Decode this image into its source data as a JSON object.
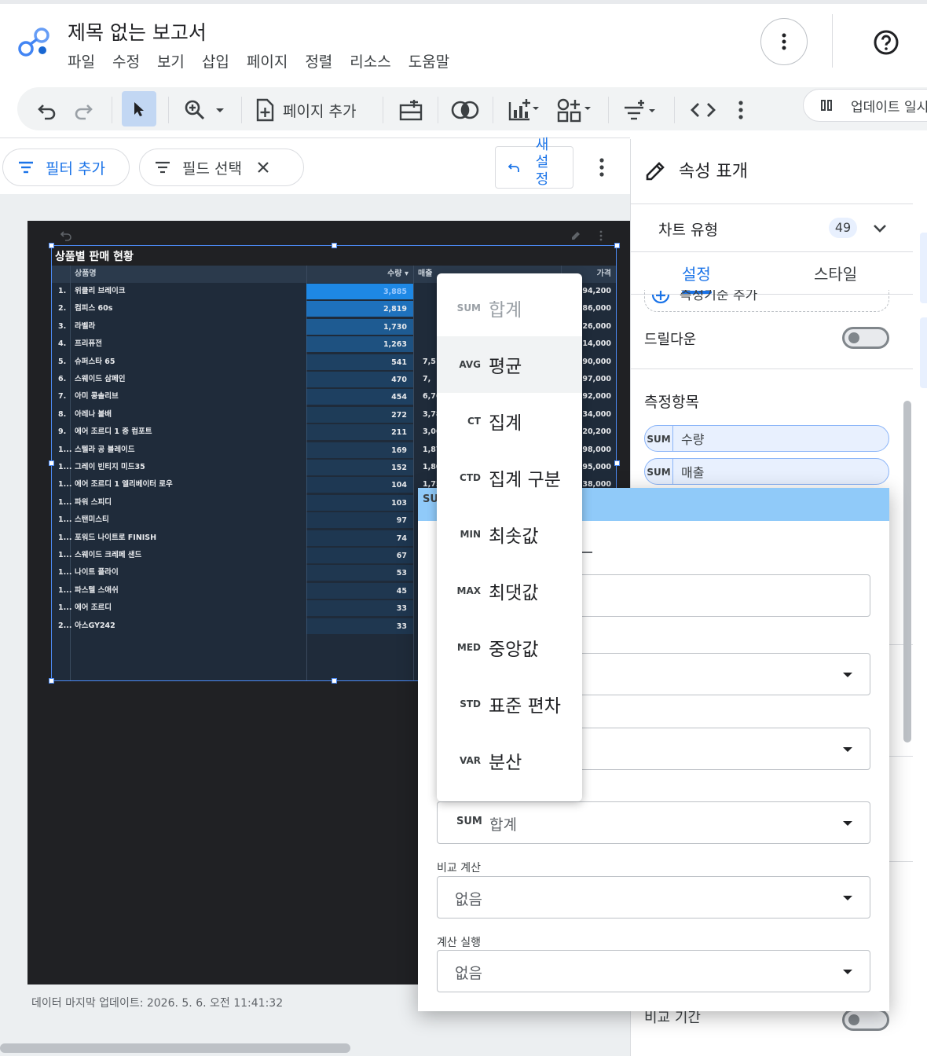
{
  "app": {
    "title": "제목 없는 보고서",
    "menu": [
      "파일",
      "수정",
      "보기",
      "삽입",
      "페이지",
      "정렬",
      "리소스",
      "도움말"
    ]
  },
  "toolbar": {
    "add_page_label": "페이지 추가",
    "update_label": "업데이트 일시"
  },
  "filterbar": {
    "add_filter_label": "필터 추가",
    "field_select_label": "필드 선택",
    "reset_label_lines": [
      "새",
      "설",
      "정"
    ]
  },
  "report": {
    "table_title": "상품별 판매 현황",
    "columns": {
      "name": "상품명",
      "qty": "수량 ▾",
      "revenue": "매출",
      "price": "가격"
    },
    "rows": [
      {
        "rank": "1.",
        "name": "위클리 브레이크",
        "qty": "3,885",
        "revenue": "",
        "price": ",794,200",
        "shade": 1.0
      },
      {
        "rank": "2.",
        "name": "컴피스 60s",
        "qty": "2,819",
        "revenue": "",
        "price": ",886,000",
        "shade": 0.73
      },
      {
        "rank": "3.",
        "name": "라벨라",
        "qty": "1,730",
        "revenue": "",
        "price": ",126,000",
        "shade": 0.45
      },
      {
        "rank": "4.",
        "name": "프리퓨전",
        "qty": "1,263",
        "revenue": "",
        "price": ",314,000",
        "shade": 0.33
      },
      {
        "rank": "5.",
        "name": "슈퍼스타 65",
        "qty": "541",
        "revenue": "7,51",
        "price": ",390,000",
        "shade": 0.14
      },
      {
        "rank": "6.",
        "name": "스웨이드 삼페인",
        "qty": "470",
        "revenue": "7,",
        "price": ",197,000",
        "shade": 0.12
      },
      {
        "rank": "7.",
        "name": "아미 콩솔리브",
        "qty": "454",
        "revenue": "6,76",
        "price": ",192,000",
        "shade": 0.12
      },
      {
        "rank": "8.",
        "name": "아레나 볼배",
        "qty": "272",
        "revenue": "3,78",
        "price": "834,000",
        "shade": 0.07
      },
      {
        "rank": "9.",
        "name": "에어 조르디 1 중 컴포트",
        "qty": "211",
        "revenue": "3,06",
        "price": "820,200",
        "shade": 0.05
      },
      {
        "rank": "1...",
        "name": "스텔라 공 블레이드",
        "qty": "169",
        "revenue": "1,87",
        "price": "198,000",
        "shade": 0.04
      },
      {
        "rank": "1...",
        "name": "그레이 빈티지 미드35",
        "qty": "152",
        "revenue": "1,80",
        "price": "595,000",
        "shade": 0.04
      },
      {
        "rank": "1...",
        "name": "에어 조르디 1 엘리베이터 로우",
        "qty": "104",
        "revenue": "1,75",
        "price": "338,000",
        "shade": 0.03
      },
      {
        "rank": "1...",
        "name": "파워 스피디",
        "qty": "103",
        "revenue": "",
        "price": "",
        "shade": 0.03
      },
      {
        "rank": "1...",
        "name": "스탠미스티",
        "qty": "97",
        "revenue": "",
        "price": "",
        "shade": 0.02
      },
      {
        "rank": "1...",
        "name": "포워드 나이트로 FINISH",
        "qty": "74",
        "revenue": "",
        "price": "",
        "shade": 0.02
      },
      {
        "rank": "1...",
        "name": "스웨이드 크레페 샌드",
        "qty": "67",
        "revenue": "",
        "price": "",
        "shade": 0.02
      },
      {
        "rank": "1...",
        "name": "나이트 플라이",
        "qty": "53",
        "revenue": "",
        "price": "",
        "shade": 0.01
      },
      {
        "rank": "1...",
        "name": "파스텔 스애쉬",
        "qty": "45",
        "revenue": "",
        "price": "",
        "shade": 0.01
      },
      {
        "rank": "1...",
        "name": "에어 조르디",
        "qty": "33",
        "revenue": "",
        "price": "",
        "shade": 0.01
      },
      {
        "rank": "2...",
        "name": "아스GY242",
        "qty": "33",
        "revenue": "",
        "price": "",
        "shade": 0.01
      }
    ],
    "footnote": "데이터 마지막 업데이트: 2026. 5. 6. 오전 11:41:32"
  },
  "panel": {
    "title": "속성 표개",
    "chart_type_label": "차트 유형",
    "chart_type_count": "49",
    "tabs": [
      "설정",
      "스타일"
    ],
    "add_metric_label": "측정기준 추가",
    "drilldown_label": "드릴다운",
    "metrics_label": "측정항목",
    "metrics": [
      {
        "agg": "SUM",
        "name": "수량"
      },
      {
        "agg": "SUM",
        "name": "매출"
      }
    ],
    "compare_period_label": "비교 기간"
  },
  "modal": {
    "head_agg": "SU",
    "aggregation_field": {
      "agg": "SUM",
      "value": "합계"
    },
    "compare_calc": {
      "label": "비교 계산",
      "value": "없음"
    },
    "running_calc": {
      "label": "계산 실행",
      "value": "없음"
    }
  },
  "agg_menu": [
    {
      "code": "SUM",
      "label": "합계",
      "state": "dim"
    },
    {
      "code": "AVG",
      "label": "평균",
      "state": "hover"
    },
    {
      "code": "CT",
      "label": "집계",
      "state": ""
    },
    {
      "code": "CTD",
      "label": "집계 구분",
      "state": ""
    },
    {
      "code": "MIN",
      "label": "최솟값",
      "state": ""
    },
    {
      "code": "MAX",
      "label": "최댓값",
      "state": ""
    },
    {
      "code": "MED",
      "label": "중앙값",
      "state": ""
    },
    {
      "code": "STD",
      "label": "표준 편차",
      "state": ""
    },
    {
      "code": "VAR",
      "label": "분산",
      "state": ""
    }
  ],
  "colors": {
    "accent": "#1a73e8",
    "bar_base": "#1e88e5",
    "modal_header": "#90caf9",
    "report_bg": "#202124"
  }
}
